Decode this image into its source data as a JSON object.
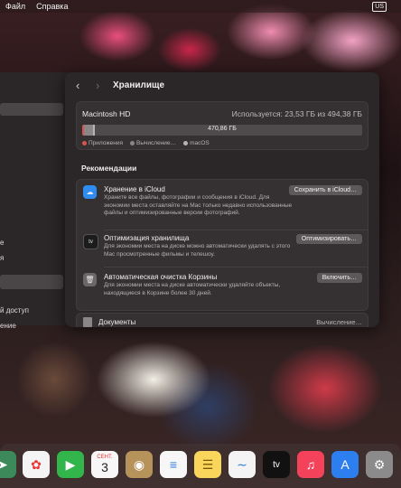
{
  "menubar": {
    "items": [
      "Файл",
      "Справка"
    ],
    "input_source": "US"
  },
  "side_window": {
    "items": [
      "е",
      "я",
      "й доступ",
      "ение"
    ]
  },
  "window": {
    "title": "Хранилище",
    "disk": {
      "name": "Macintosh HD",
      "used_text": "Используется: 23,53 ГБ из 494,38 ГБ",
      "free_label": "470,86 ГБ",
      "used_fraction": 0.048,
      "legend": [
        {
          "label": "Приложения",
          "color": "#d9534f"
        },
        {
          "label": "Вычисление…",
          "color": "#8a8688"
        },
        {
          "label": "macOS",
          "color": "#b8b4b6"
        }
      ]
    },
    "recommendations_title": "Рекомендации",
    "recommendations": [
      {
        "icon": "icloud-icon",
        "title": "Хранение в iCloud",
        "description": "Храните все файлы, фотографии и сообщения в iCloud. Для экономии места оставляйте на Mac только недавно использованные файлы и оптимизированные версии фотографий.",
        "button": "Сохранить в iCloud…"
      },
      {
        "icon": "apple-tv-icon",
        "title": "Оптимизация хранилища",
        "description": "Для экономии места на диске можно автоматически удалять с этого Mac просмотренные фильмы и телешоу.",
        "button": "Оптимизировать…"
      },
      {
        "icon": "trash-icon",
        "title": "Автоматическая очистка Корзины",
        "description": "Для экономии места на диске автоматически удаляйте объекты, находящиеся в Корзине более 30 дней.",
        "button": "Включить…"
      }
    ],
    "documents": {
      "label": "Документы",
      "status": "Вычисление…"
    }
  },
  "dock": {
    "calendar_month": "СЕНТ.",
    "calendar_day": "3",
    "tv_label": "tv"
  }
}
